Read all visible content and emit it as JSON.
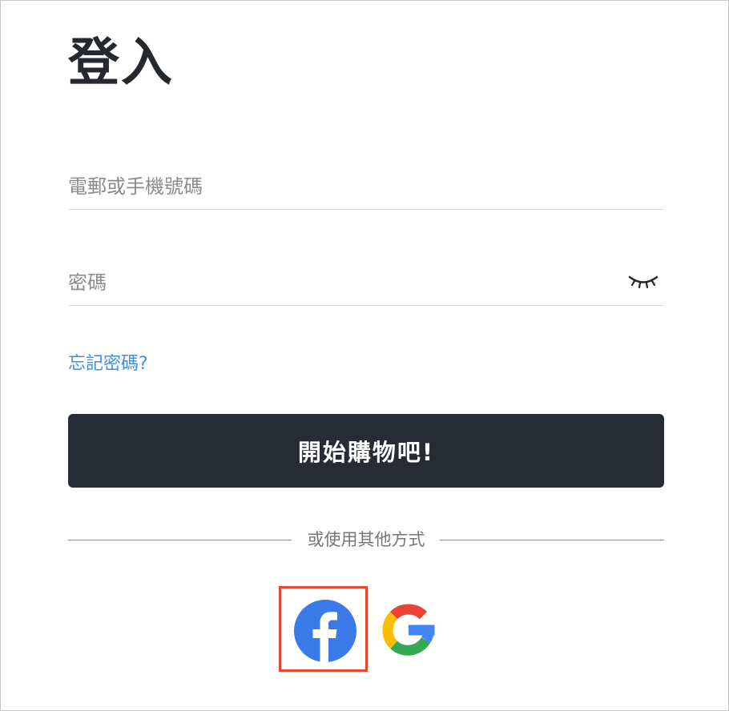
{
  "login": {
    "title": "登入",
    "email": {
      "placeholder": "電郵或手機號碼",
      "value": ""
    },
    "password": {
      "placeholder": "密碼",
      "value": ""
    },
    "forgot_password": "忘記密碼?",
    "submit_label": "開始購物吧!",
    "divider_text": "或使用其他方式",
    "social": [
      {
        "name": "facebook",
        "icon": "facebook-icon",
        "color": "#3b7be8",
        "highlighted": true
      },
      {
        "name": "google",
        "icon": "google-icon"
      }
    ]
  },
  "colors": {
    "title": "#25282f",
    "button_bg": "#272b33",
    "link": "#3f8fdc",
    "highlight_border": "#e04a2f",
    "facebook_blue": "#3b7be8"
  },
  "icons": {
    "password_toggle": "eye-closed-icon"
  }
}
